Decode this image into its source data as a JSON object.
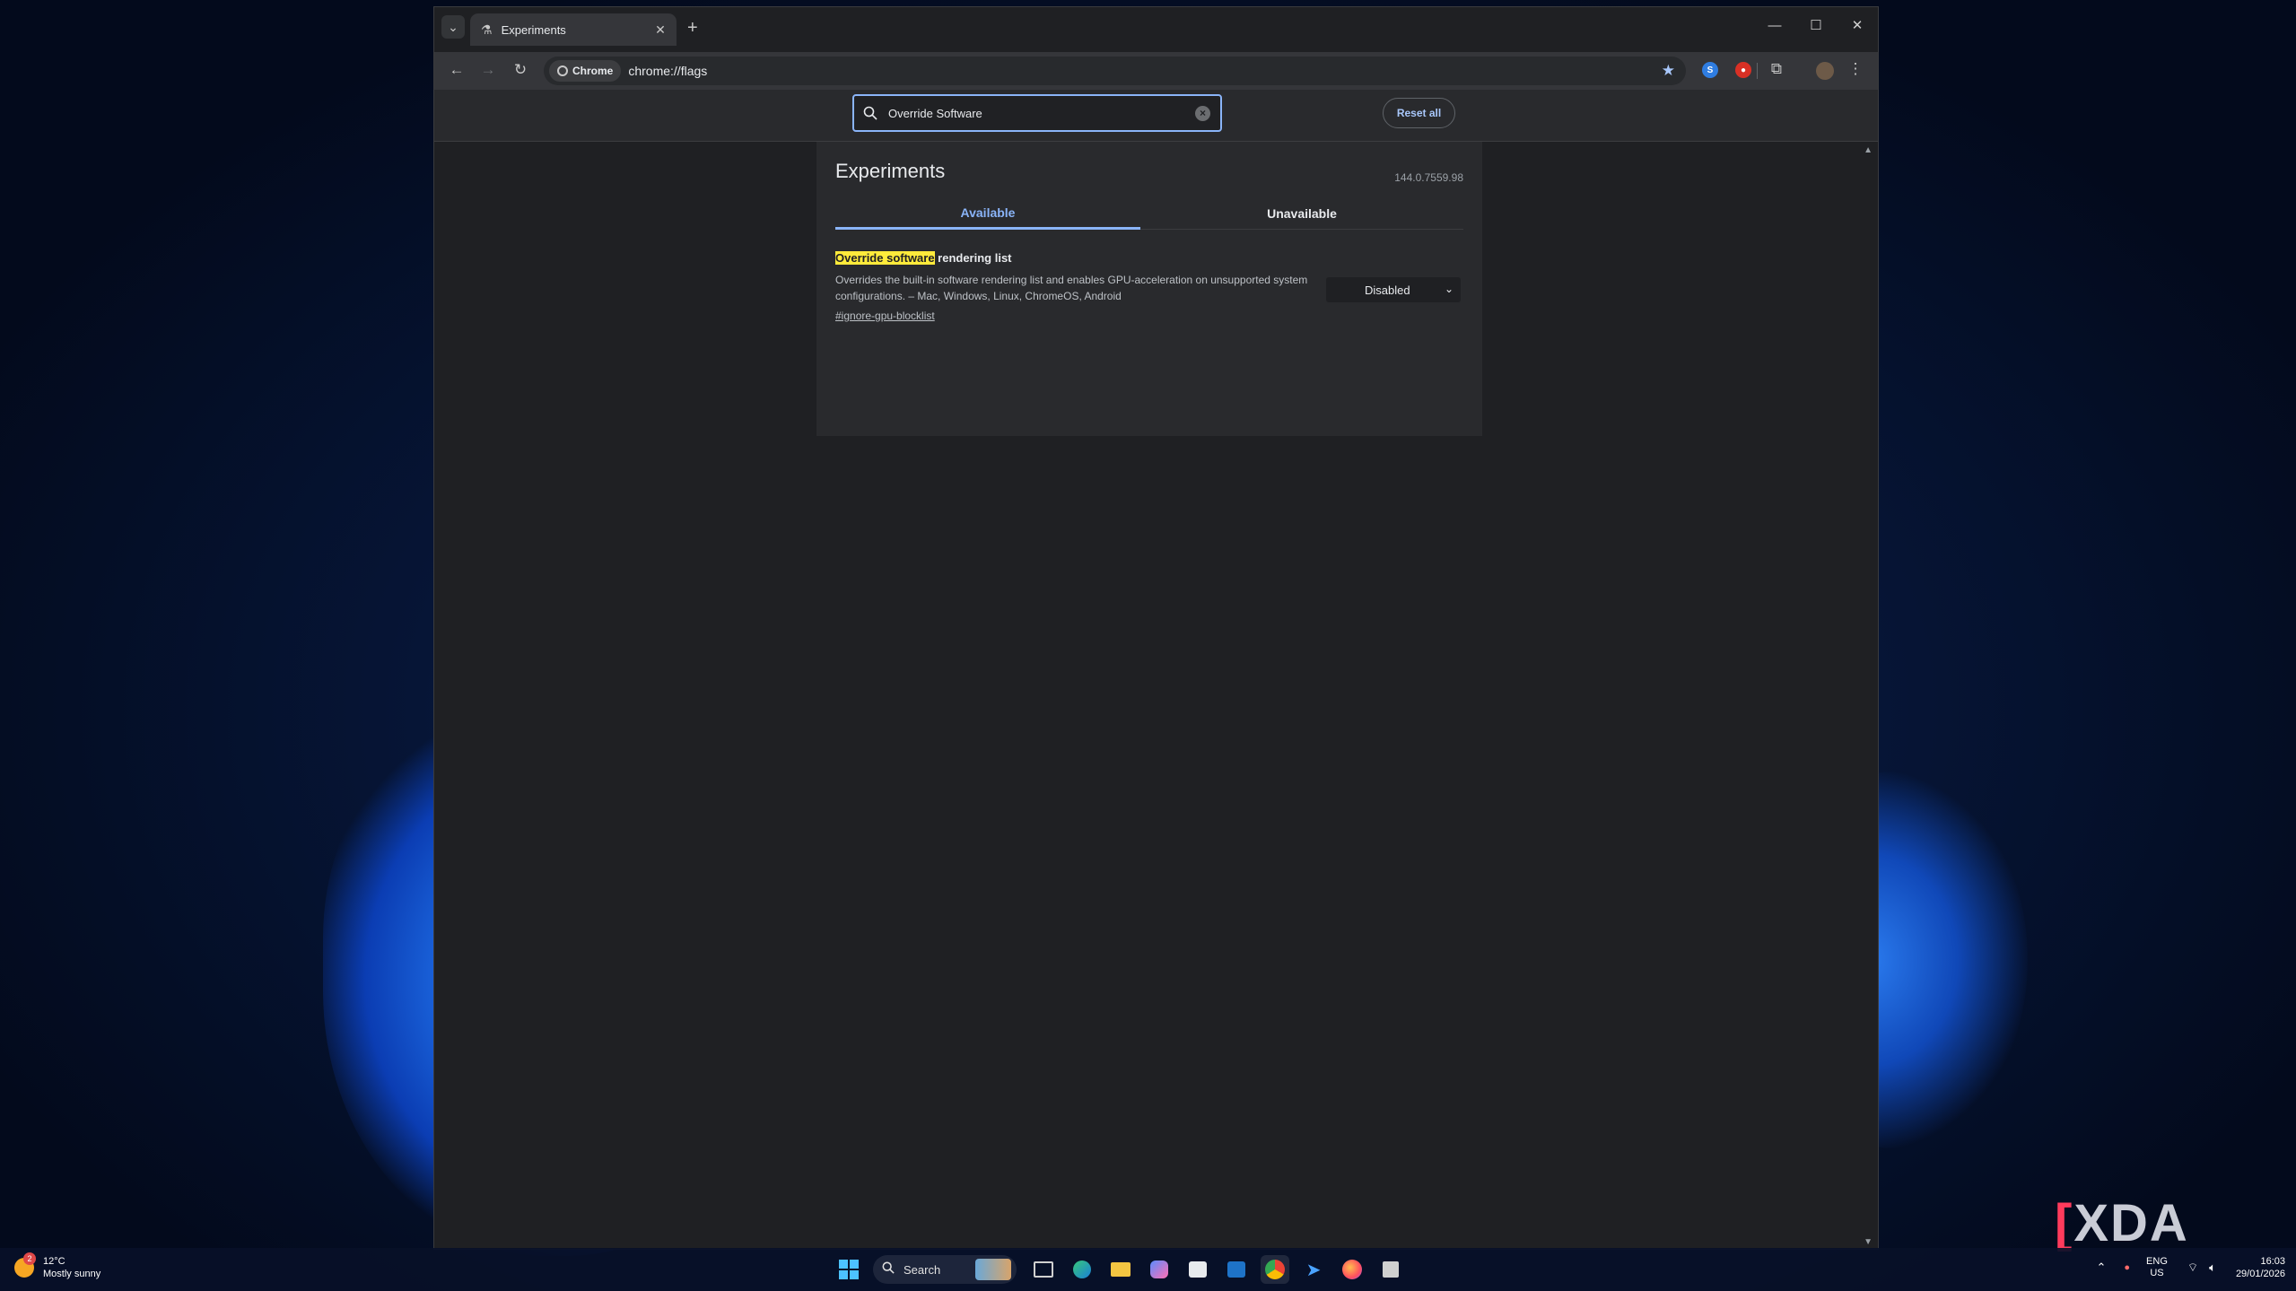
{
  "browser": {
    "tab_title": "Experiments",
    "omnibox_chip": "Chrome",
    "url": "chrome://flags"
  },
  "flags": {
    "search_value": "Override Software",
    "reset_label": "Reset all",
    "page_title": "Experiments",
    "version": "144.0.7559.98",
    "tabs": [
      "Available",
      "Unavailable"
    ],
    "experiment": {
      "name_highlight": "Override software",
      "name_rest": " rendering list",
      "description": "Overrides the built-in software rendering list and enables GPU-acceleration on unsupported system configurations. – Mac, Windows, Linux, ChromeOS, Android",
      "link": "#ignore-gpu-blocklist",
      "state": "Disabled"
    }
  },
  "taskbar": {
    "weather_temp": "12°C",
    "weather_desc": "Mostly sunny",
    "weather_badge": "2",
    "search_label": "Search",
    "lang_top": "ENG",
    "lang_bottom": "US",
    "time": "16:03",
    "date": "29/01/2026"
  },
  "watermark": "XDA",
  "colors": {
    "accent": "#8ab4f8",
    "highlight": "#ffeb3b",
    "panel": "#292a2d",
    "page_bg": "#1f2023"
  }
}
